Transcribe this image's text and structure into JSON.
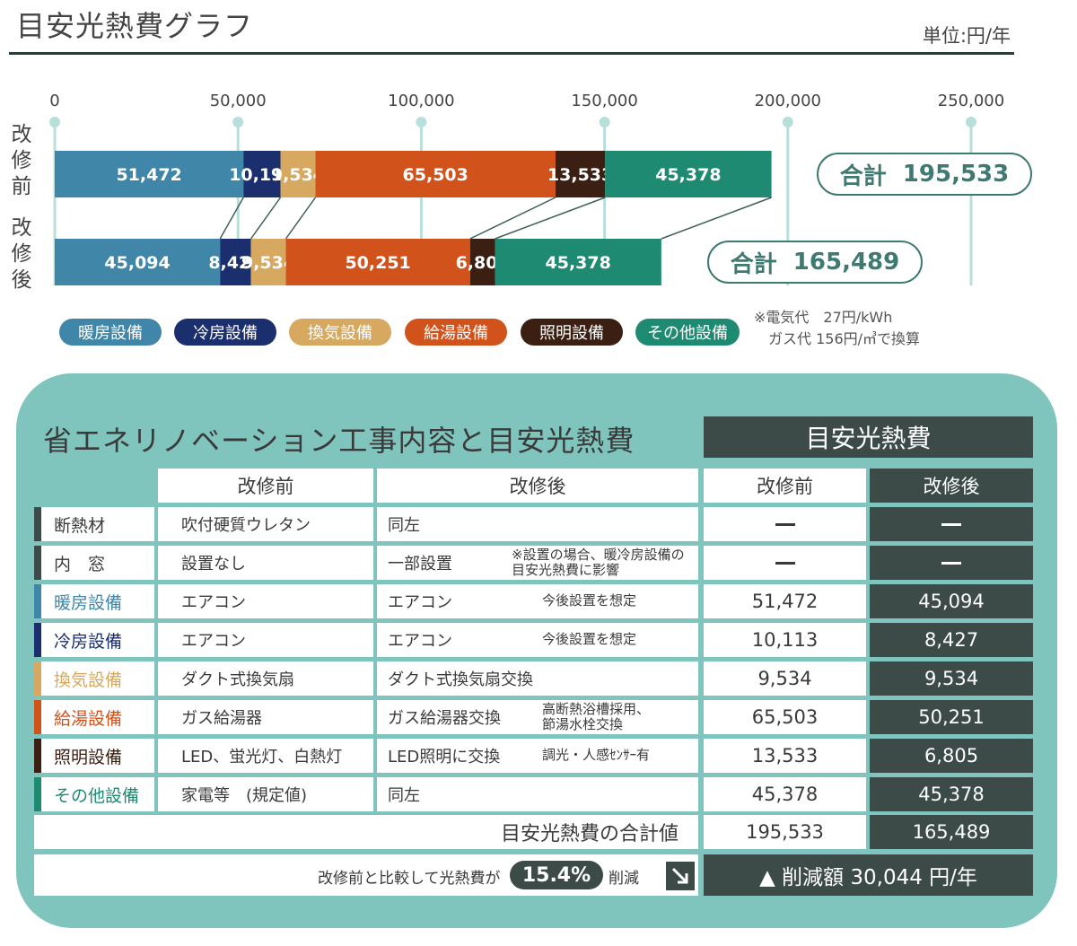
{
  "header": {
    "title": "目安光熱費グラフ",
    "unit": "単位:円/年"
  },
  "chart_data": {
    "type": "bar",
    "orientation": "horizontal",
    "stacked": true,
    "xlim": [
      0,
      250000
    ],
    "ticks": [
      "0",
      "50,000",
      "100,000",
      "150,000",
      "200,000",
      "250,000"
    ],
    "tick_values": [
      0,
      50000,
      100000,
      150000,
      200000,
      250000
    ],
    "categories": [
      "改修前",
      "改修後"
    ],
    "category_labels": [
      [
        "改",
        "修",
        "前"
      ],
      [
        "改",
        "修",
        "後"
      ]
    ],
    "series": [
      {
        "name": "暖房設備",
        "color": "#3f86a8",
        "values": [
          51472,
          45094
        ],
        "labels": [
          "51,472",
          "45,094"
        ]
      },
      {
        "name": "冷房設備",
        "color": "#1b2f6e",
        "values": [
          10113,
          8427
        ],
        "labels": [
          "10,113",
          "8,427"
        ]
      },
      {
        "name": "換気設備",
        "color": "#d6a860",
        "values": [
          9534,
          9534
        ],
        "labels": [
          "9,534",
          "9,534"
        ]
      },
      {
        "name": "給湯設備",
        "color": "#d2521c",
        "values": [
          65503,
          50251
        ],
        "labels": [
          "65,503",
          "50,251"
        ]
      },
      {
        "name": "照明設備",
        "color": "#3a1f12",
        "values": [
          13533,
          6805
        ],
        "labels": [
          "13,533",
          "6,805"
        ]
      },
      {
        "name": "その他設備",
        "color": "#1f8a72",
        "values": [
          45378,
          45378
        ],
        "labels": [
          "45,378",
          "45,378"
        ]
      }
    ],
    "totals": [
      {
        "label": "合計",
        "value": "195,533"
      },
      {
        "label": "合計",
        "value": "165,489"
      }
    ],
    "legend_position": "bottom",
    "grid": true
  },
  "notes": {
    "line1": "※電気代　27円/kWh",
    "line2": "ガス代  156円/㎥で換算"
  },
  "panel": {
    "title": "省エネリノベーション工事内容と目安光熱費",
    "cost_header": "目安光熱費",
    "col_before": "改修前",
    "col_after": "改修後",
    "cost_before": "改修前",
    "cost_after": "改修後",
    "rows": [
      {
        "label": "断熱材",
        "stripe": "#3c4b48",
        "labelColor": "#3a3a3a",
        "before": "吹付硬質ウレタン",
        "after": "同左",
        "after_note": "",
        "cost_before": "",
        "cost_after": ""
      },
      {
        "label": "内　窓",
        "stripe": "#3c4b48",
        "labelColor": "#3a3a3a",
        "before": "設置なし",
        "after": "一部設置",
        "after_note": "※設置の場合、暖冷房設備の\n目安光熱費に影響",
        "cost_before": "",
        "cost_after": ""
      },
      {
        "label": "暖房設備",
        "stripe": "#3f86a8",
        "labelColor": "#3f86a8",
        "before": "エアコン",
        "after": "エアコン",
        "after_note": "今後設置を想定",
        "cost_before": "51,472",
        "cost_after": "45,094"
      },
      {
        "label": "冷房設備",
        "stripe": "#1b2f6e",
        "labelColor": "#1b2f6e",
        "before": "エアコン",
        "after": "エアコン",
        "after_note": "今後設置を想定",
        "cost_before": "10,113",
        "cost_after": "8,427"
      },
      {
        "label": "換気設備",
        "stripe": "#d6a860",
        "labelColor": "#d6a860",
        "before": "ダクト式換気扇",
        "after": "ダクト式換気扇交換",
        "after_note": "",
        "cost_before": "9,534",
        "cost_after": "9,534"
      },
      {
        "label": "給湯設備",
        "stripe": "#d2521c",
        "labelColor": "#d2521c",
        "before": "ガス給湯器",
        "after": "ガス給湯器交換",
        "after_note": "高断熱浴槽採用、\n節湯水栓交換",
        "cost_before": "65,503",
        "cost_after": "50,251"
      },
      {
        "label": "照明設備",
        "stripe": "#3a1f12",
        "labelColor": "#3a1f12",
        "before": "LED、蛍光灯、白熱灯",
        "after": "LED照明に交換",
        "after_note": "調光・人感ｾﾝｻｰ有",
        "cost_before": "13,533",
        "cost_after": "6,805"
      },
      {
        "label": "その他設備",
        "stripe": "#1f8a72",
        "labelColor": "#1f8a72",
        "before": "家電等　(規定値)",
        "after": "同左",
        "after_note": "",
        "cost_before": "45,378",
        "cost_after": "45,378"
      }
    ],
    "total_label": "目安光熱費の合計値",
    "total_before": "195,533",
    "total_after": "165,489",
    "compare_text": "改修前と比較して光熱費が",
    "compare_percent": "15.4%",
    "compare_suffix": "削減",
    "reduction_icon": "arrow-down-right-icon",
    "reduction_text": "▲ 削減額 30,044 円/年"
  }
}
